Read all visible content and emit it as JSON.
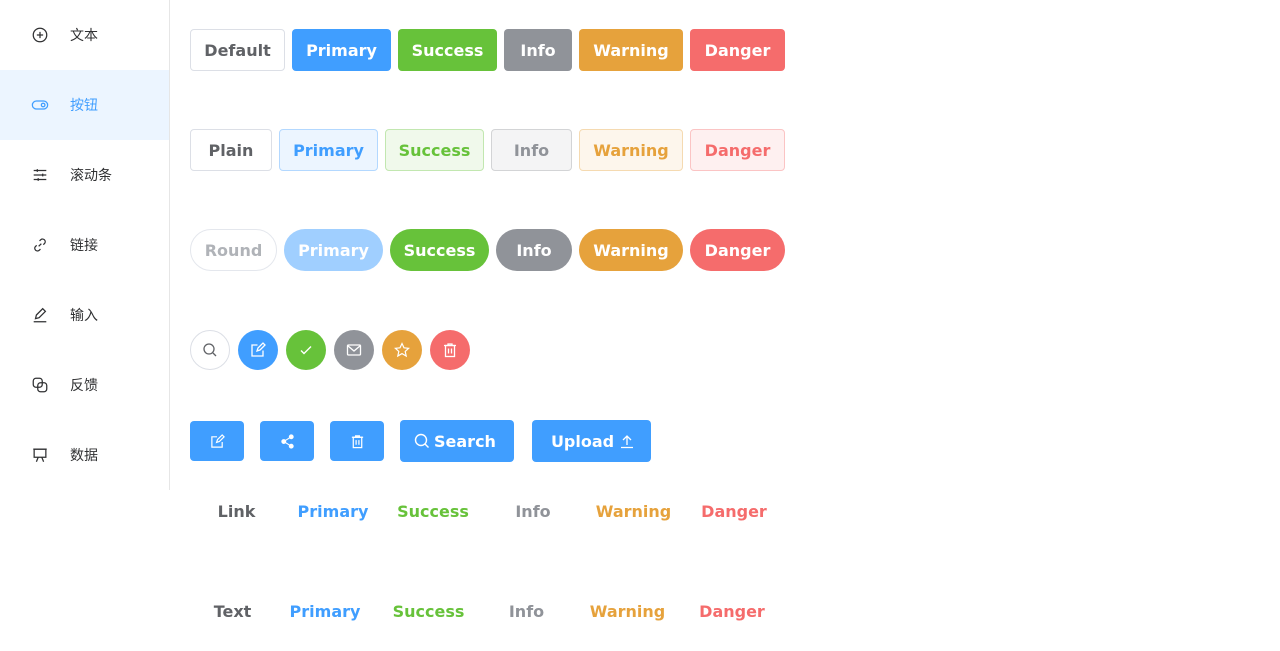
{
  "sidebar": {
    "items": [
      {
        "label": "文本",
        "icon": "plus-circle-icon"
      },
      {
        "label": "按钮",
        "icon": "toggle-icon"
      },
      {
        "label": "滚动条",
        "icon": "sliders-icon"
      },
      {
        "label": "链接",
        "icon": "link-icon"
      },
      {
        "label": "输入",
        "icon": "edit-pen-icon"
      },
      {
        "label": "反馈",
        "icon": "copy-icon"
      },
      {
        "label": "数据",
        "icon": "presentation-board-icon"
      }
    ],
    "active_index": 1
  },
  "buttons_row": [
    "Default",
    "Primary",
    "Success",
    "Info",
    "Warning",
    "Danger"
  ],
  "plain_row": [
    "Plain",
    "Primary",
    "Success",
    "Info",
    "Warning",
    "Danger"
  ],
  "round_row": [
    "Round",
    "Primary",
    "Success",
    "Info",
    "Warning",
    "Danger"
  ],
  "circle_row": [
    "search-icon",
    "edit-icon",
    "check-icon",
    "mail-icon",
    "star-icon",
    "delete-icon"
  ],
  "icon_row": {
    "icons": [
      "edit-icon",
      "share-icon",
      "delete-icon"
    ],
    "search_label": "Search",
    "upload_label": "Upload"
  },
  "link_row": [
    "Link",
    "Primary",
    "Success",
    "Info",
    "Warning",
    "Danger"
  ],
  "text_row": [
    "Text",
    "Primary",
    "Success",
    "Info",
    "Warning",
    "Danger"
  ],
  "colors": {
    "primary": "#409eff",
    "success": "#67c23a",
    "info": "#909399",
    "warning": "#e6a23c",
    "danger": "#f56c6c"
  }
}
